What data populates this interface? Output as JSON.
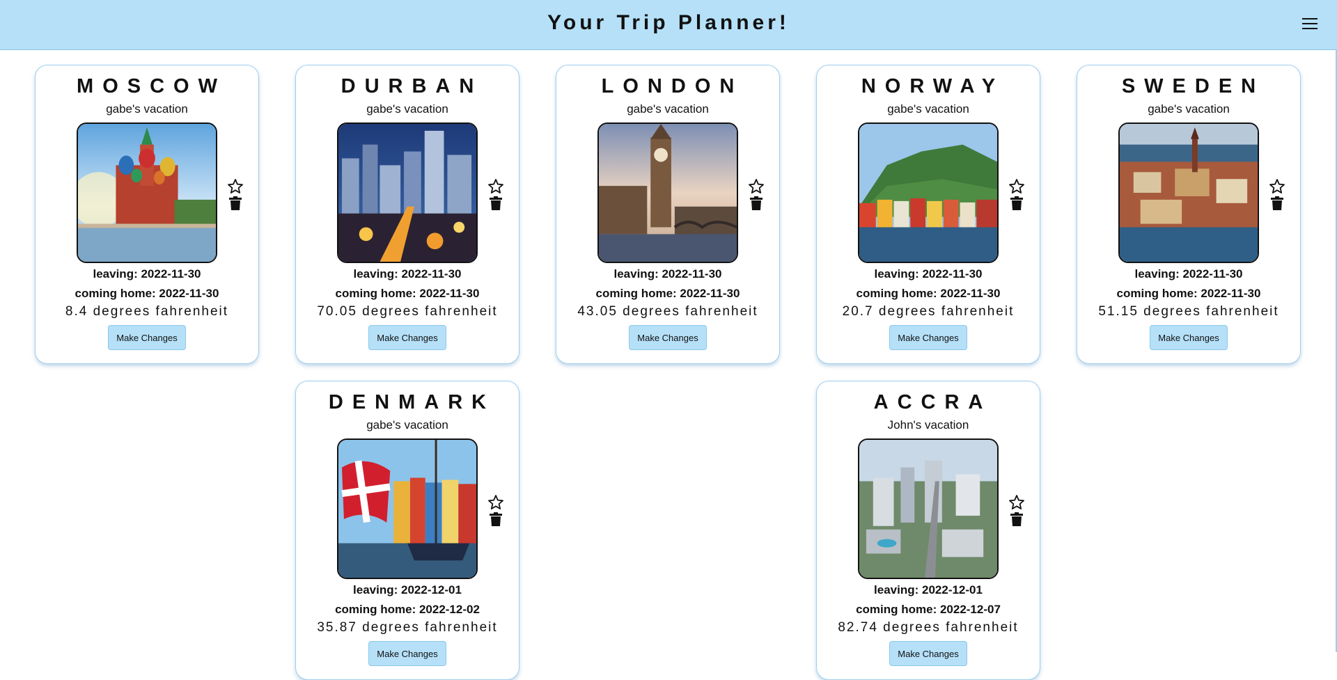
{
  "header": {
    "title": "Your Trip Planner!",
    "menu_icon": "hamburger-menu-icon"
  },
  "trips": [
    {
      "city": "MOSCOW",
      "owner": "gabe's vacation",
      "leaving": "leaving: 2022-11-30",
      "coming_home": "coming home: 2022-11-30",
      "temperature": "8.4 degrees fahrenheit",
      "button": "Make Changes",
      "photo": "moscow-cathedral-photo"
    },
    {
      "city": "DURBAN",
      "owner": "gabe's vacation",
      "leaving": "leaving: 2022-11-30",
      "coming_home": "coming home: 2022-11-30",
      "temperature": "70.05 degrees fahrenheit",
      "button": "Make Changes",
      "photo": "durban-night-city-photo"
    },
    {
      "city": "LONDON",
      "owner": "gabe's vacation",
      "leaving": "leaving: 2022-11-30",
      "coming_home": "coming home: 2022-11-30",
      "temperature": "43.05 degrees fahrenheit",
      "button": "Make Changes",
      "photo": "london-big-ben-photo"
    },
    {
      "city": "NORWAY",
      "owner": "gabe's vacation",
      "leaving": "leaving: 2022-11-30",
      "coming_home": "coming home: 2022-11-30",
      "temperature": "20.7 degrees fahrenheit",
      "button": "Make Changes",
      "photo": "norway-harbor-photo"
    },
    {
      "city": "SWEDEN",
      "owner": "gabe's vacation",
      "leaving": "leaving: 2022-11-30",
      "coming_home": "coming home: 2022-11-30",
      "temperature": "51.15 degrees fahrenheit",
      "button": "Make Changes",
      "photo": "stockholm-aerial-photo"
    },
    {
      "city": "DENMARK",
      "owner": "gabe's vacation",
      "leaving": "leaving: 2022-12-01",
      "coming_home": "coming home: 2022-12-02",
      "temperature": "35.87 degrees fahrenheit",
      "button": "Make Changes",
      "photo": "copenhagen-nyhavn-flag-photo"
    },
    {
      "city": "ACCRA",
      "owner": "John's vacation",
      "leaving": "leaving: 2022-12-01",
      "coming_home": "coming home: 2022-12-07",
      "temperature": "82.74 degrees fahrenheit",
      "button": "Make Changes",
      "photo": "accra-aerial-city-photo"
    }
  ],
  "icons": {
    "favorite": "star-outline-icon",
    "delete": "trash-icon"
  }
}
